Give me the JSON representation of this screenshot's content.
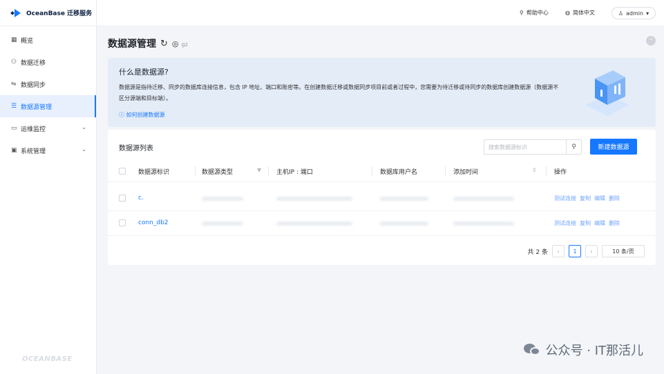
{
  "app": {
    "brand": "OceanBase 迁移服务",
    "footer_brand": "OCEANBASE"
  },
  "topbar": {
    "help": "帮助中心",
    "language": "简体中文",
    "user": "admin"
  },
  "sidebar": {
    "items": [
      {
        "label": "概览",
        "icon": "grid-icon"
      },
      {
        "label": "数据迁移",
        "icon": "migration-icon"
      },
      {
        "label": "数据同步",
        "icon": "sync-icon"
      },
      {
        "label": "数据源管理",
        "icon": "datasource-icon",
        "active": true
      },
      {
        "label": "运维监控",
        "icon": "monitor-icon",
        "expandable": true
      },
      {
        "label": "系统管理",
        "icon": "settings-icon",
        "expandable": true
      }
    ]
  },
  "page": {
    "title": "数据源管理",
    "region": "gz"
  },
  "banner": {
    "title": "什么是数据源?",
    "desc": "数据源是指待迁移、同步的数据库连接信息，包含 IP 地址、端口和账密等。在创建数据迁移或数据同步项目前或者过程中，您需要为待迁移或待同步的数据库创建数据源（数据源不区分源端和目标端）。",
    "link": "如何创建数据源"
  },
  "list": {
    "title": "数据源列表",
    "search_placeholder": "搜索数据源标识",
    "new_button": "新建数据源",
    "columns": [
      "数据源标识",
      "数据源类型",
      "主机IP : 端口",
      "数据库用户名",
      "添加时间",
      "操作"
    ],
    "rows": [
      {
        "name": "c."
      },
      {
        "name": "conn_db2"
      }
    ],
    "actions": [
      "测试连接",
      "复制",
      "编辑",
      "删除"
    ]
  },
  "pagination": {
    "total": "共 2 条",
    "current_page": "1",
    "page_size": "10 条/页"
  },
  "watermark": "公众号 · IT那活儿",
  "colors": {
    "accent": "#1677ff",
    "banner_bg": "#e4ecf8",
    "main_bg": "#f4f5f8"
  }
}
